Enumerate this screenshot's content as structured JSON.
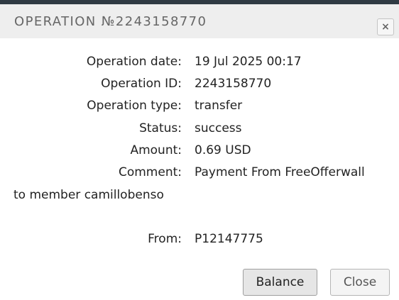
{
  "dialog": {
    "title": "OPERATION №2243158770",
    "close_icon": "×"
  },
  "details": {
    "operation_date": {
      "label": "Operation date:",
      "value": "19 Jul 2025 00:17"
    },
    "operation_id": {
      "label": "Operation ID:",
      "value": "2243158770"
    },
    "operation_type": {
      "label": "Operation type:",
      "value": "transfer"
    },
    "status": {
      "label": "Status:",
      "value": "success"
    },
    "amount": {
      "label": "Amount:",
      "value": "0.69 USD"
    },
    "comment": {
      "label": "Comment:",
      "value": "Payment From FreeOfferwall",
      "value_continued": "to member camillobenso"
    },
    "from": {
      "label": "From:",
      "value": "P12147775"
    }
  },
  "buttons": {
    "balance": "Balance",
    "close": "Close"
  }
}
